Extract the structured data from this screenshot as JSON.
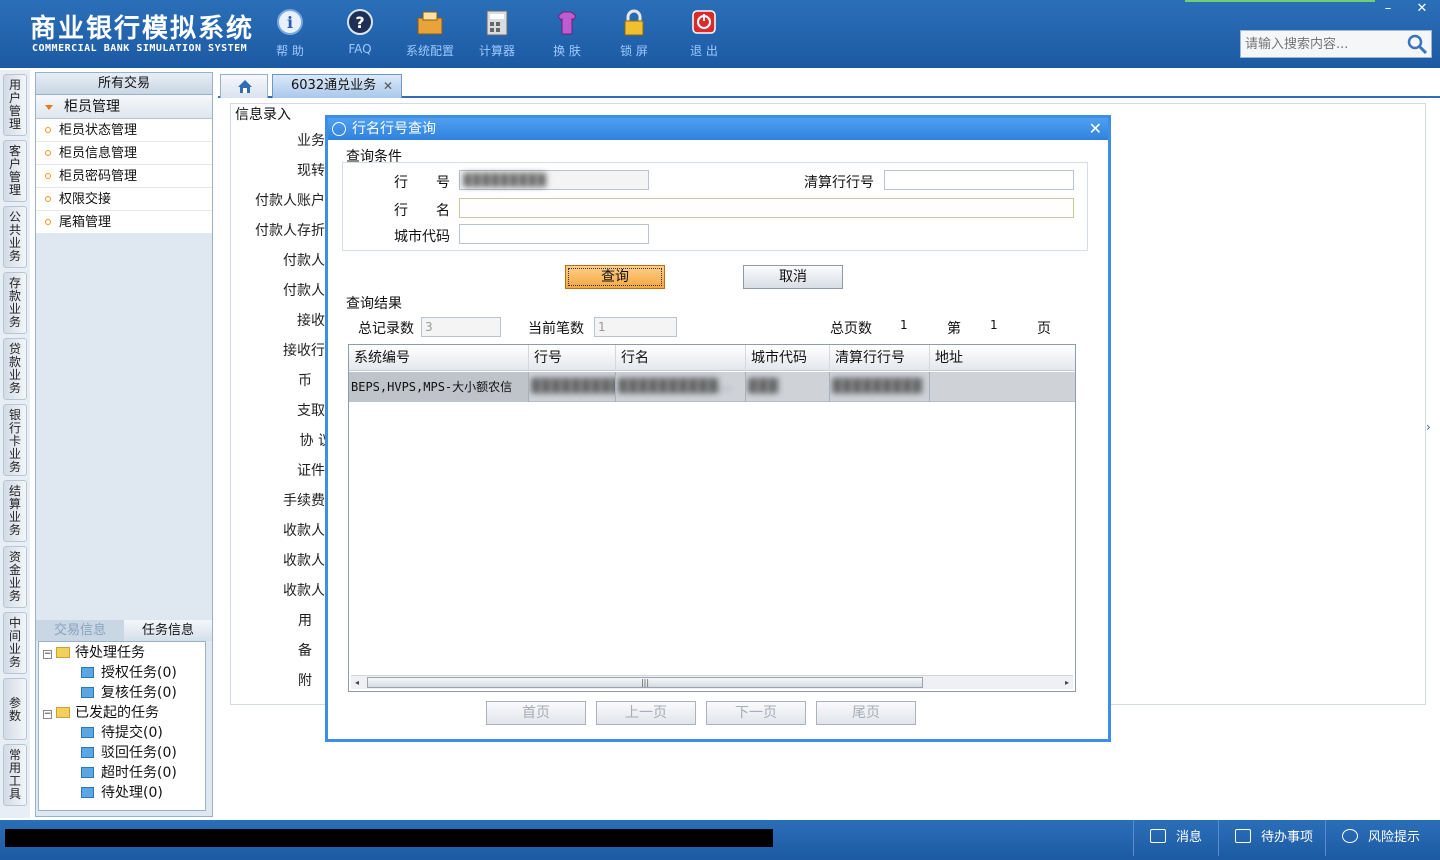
{
  "app": {
    "title_cn": "商业银行模拟系统",
    "title_en": "COMMERCIAL BANK SIMULATION SYSTEM"
  },
  "toolbar": [
    {
      "label": "帮 助",
      "icon": "help-icon"
    },
    {
      "label": "FAQ",
      "icon": "faq-icon"
    },
    {
      "label": "系统配置",
      "icon": "config-icon"
    },
    {
      "label": "计算器",
      "icon": "calculator-icon"
    },
    {
      "label": "换 肤",
      "icon": "skin-icon"
    },
    {
      "label": "锁 屏",
      "icon": "lock-icon"
    },
    {
      "label": "退 出",
      "icon": "exit-icon"
    }
  ],
  "search": {
    "placeholder": "请输入搜索内容..."
  },
  "window_controls": {
    "minimize": "–",
    "close": "✕"
  },
  "categories": [
    "用户管理",
    "客户管理",
    "公共业务",
    "存款业务",
    "贷款业务",
    "银行卡业务",
    "结算业务",
    "资金业务",
    "中间业务",
    "参数",
    "常用工具"
  ],
  "tree": {
    "header": "所有交易",
    "group": "柜员管理",
    "items": [
      "柜员状态管理",
      "柜员信息管理",
      "柜员密码管理",
      "权限交接",
      "尾箱管理"
    ]
  },
  "task_panel": {
    "tabs": [
      "交易信息",
      "任务信息"
    ],
    "pending": "待处理任务",
    "pending_children": [
      "授权任务(0)",
      "复核任务(0)"
    ],
    "initiated": "已发起的任务",
    "initiated_children": [
      "待提交(0)",
      "驳回任务(0)",
      "超时任务(0)",
      "待处理(0)"
    ]
  },
  "main_tabs": {
    "home_icon": "home-icon",
    "active_tab": "6032通兑业务",
    "close": "✕"
  },
  "form": {
    "title": "信息录入",
    "labels": [
      "业务",
      "现转",
      "付款人账户",
      "付款人存折",
      "付款人",
      "付款人",
      "接收",
      "接收行",
      "币",
      "支取",
      "协 议",
      "证件",
      "手续费",
      "收款人",
      "收款人",
      "收款人",
      "用",
      "备",
      "附"
    ]
  },
  "dialog": {
    "title": "行名行号查询",
    "close": "✕",
    "conditions_title": "查询条件",
    "bank_no_label": "行　　号",
    "bank_no_value": "█████████",
    "clearing_no_label": "清算行行号",
    "bank_name_label": "行　　名",
    "city_code_label": "城市代码",
    "query_button": "查询",
    "cancel_button": "取消",
    "results_title": "查询结果",
    "total_records_label": "总记录数",
    "total_records_value": "3",
    "current_label": "当前笔数",
    "current_value": "1",
    "total_pages_label": "总页数",
    "total_pages_value": "1",
    "page_prefix": "第",
    "page_value": "1",
    "page_suffix": "页",
    "columns": [
      "系统编号",
      "行号",
      "行名",
      "城市代码",
      "清算行行号",
      "地址"
    ],
    "row": [
      "BEPS,HVPS,MPS-大小额农信",
      "████████████",
      "██████████…",
      "███",
      "█████████",
      ""
    ],
    "pager": [
      "首页",
      "上一页",
      "下一页",
      "尾页"
    ]
  },
  "statusbar": [
    {
      "label": "消息",
      "icon": "mail-icon"
    },
    {
      "label": "待办事项",
      "icon": "checkbox-icon"
    },
    {
      "label": "风险提示",
      "icon": "chat-icon"
    }
  ]
}
